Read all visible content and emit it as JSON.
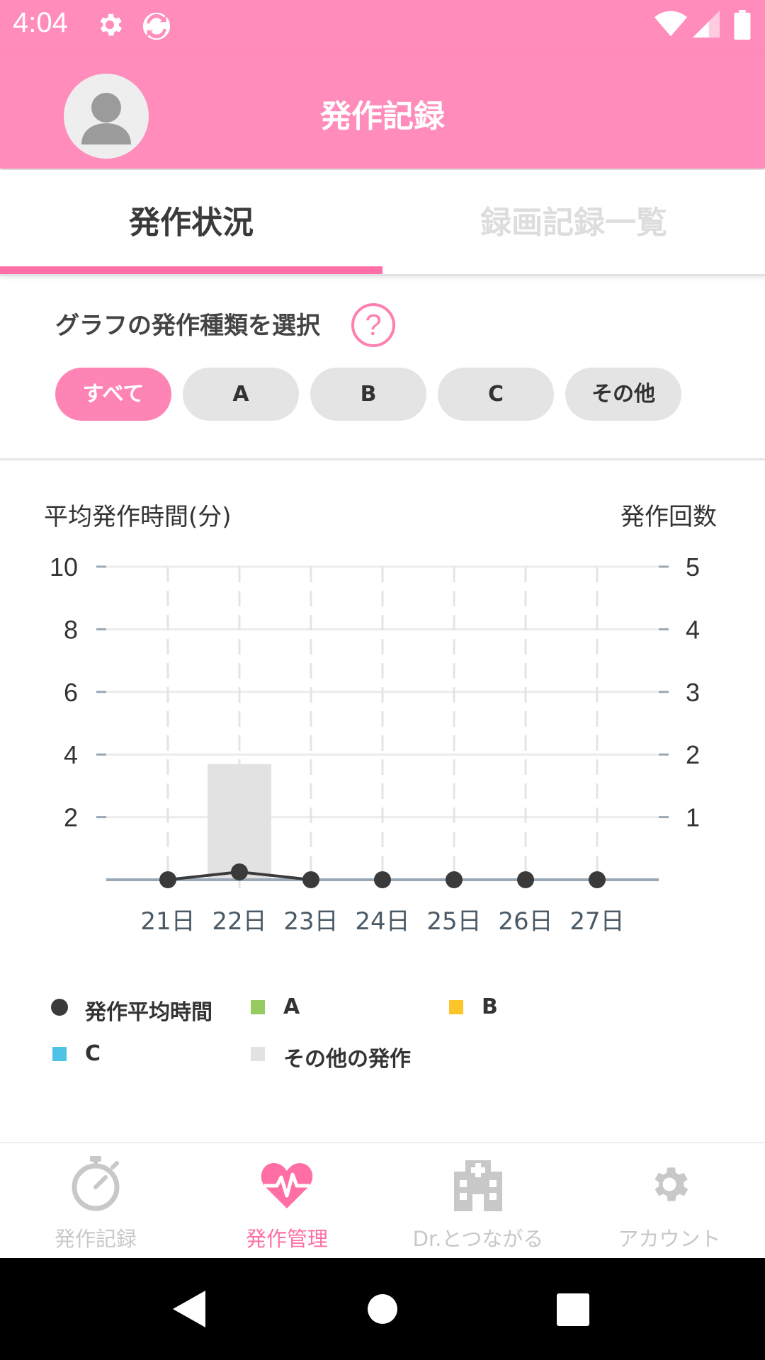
{
  "status_bar": {
    "time": "4:04",
    "icons": [
      "gear-icon",
      "app-sync-icon",
      "wifi-icon",
      "cell-signal-icon",
      "battery-icon"
    ]
  },
  "header": {
    "title": "発作記録",
    "avatar_icon": "person-icon"
  },
  "tabs": [
    {
      "label": "発作状況",
      "selected": true
    },
    {
      "label": "録画記録一覧",
      "selected": false
    }
  ],
  "filter": {
    "title": "グラフの発作種類を選択",
    "help_icon": "question-icon",
    "chips": [
      {
        "label": "すべて",
        "selected": true
      },
      {
        "label": "A",
        "selected": false
      },
      {
        "label": "B",
        "selected": false
      },
      {
        "label": "C",
        "selected": false
      },
      {
        "label": "その他",
        "selected": false
      }
    ]
  },
  "chart_labels": {
    "left": "平均発作時間(分)",
    "right": "発作回数"
  },
  "chart_data": {
    "type": "bar",
    "categories": [
      "21日",
      "22日",
      "23日",
      "24日",
      "25日",
      "26日",
      "27日"
    ],
    "left_axis": {
      "ticks": [
        2,
        4,
        6,
        8,
        10
      ],
      "ylim": [
        0,
        10
      ]
    },
    "right_axis": {
      "ticks": [
        1,
        2,
        3,
        4,
        5
      ],
      "ylim": [
        0,
        5
      ]
    },
    "series": [
      {
        "name": "その他の発作",
        "type": "bar",
        "axis": "left",
        "values": [
          0,
          3.7,
          0,
          0,
          0,
          0,
          0
        ],
        "color": "#e2e2e2"
      },
      {
        "name": "発作平均時間",
        "type": "line",
        "axis": "left",
        "values": [
          0,
          0.25,
          0,
          0,
          0,
          0,
          0
        ],
        "color": "#3a3a3a"
      }
    ],
    "grid": true
  },
  "legend": [
    {
      "label": "発作平均時間",
      "color": "#3a3a3a",
      "marker": "dot"
    },
    {
      "label": "A",
      "color": "#96cb5f",
      "marker": "square"
    },
    {
      "label": "B",
      "color": "#fcc62a",
      "marker": "square"
    },
    {
      "label": "C",
      "color": "#4fc3e6",
      "marker": "square"
    },
    {
      "label": "その他の発作",
      "color": "#e2e2e2",
      "marker": "square"
    }
  ],
  "bottom_nav": [
    {
      "label": "発作記録",
      "icon": "stopwatch-icon",
      "active": false
    },
    {
      "label": "発作管理",
      "icon": "heart-pulse-icon",
      "active": true
    },
    {
      "label": "Dr.とつながる",
      "icon": "hospital-icon",
      "active": false
    },
    {
      "label": "アカウント",
      "icon": "gear-icon",
      "active": false
    }
  ],
  "colors": {
    "brand_pink": "#ff8cbb",
    "accent_pink": "#ff6fa6",
    "inactive_gray": "#c8c8c8"
  }
}
